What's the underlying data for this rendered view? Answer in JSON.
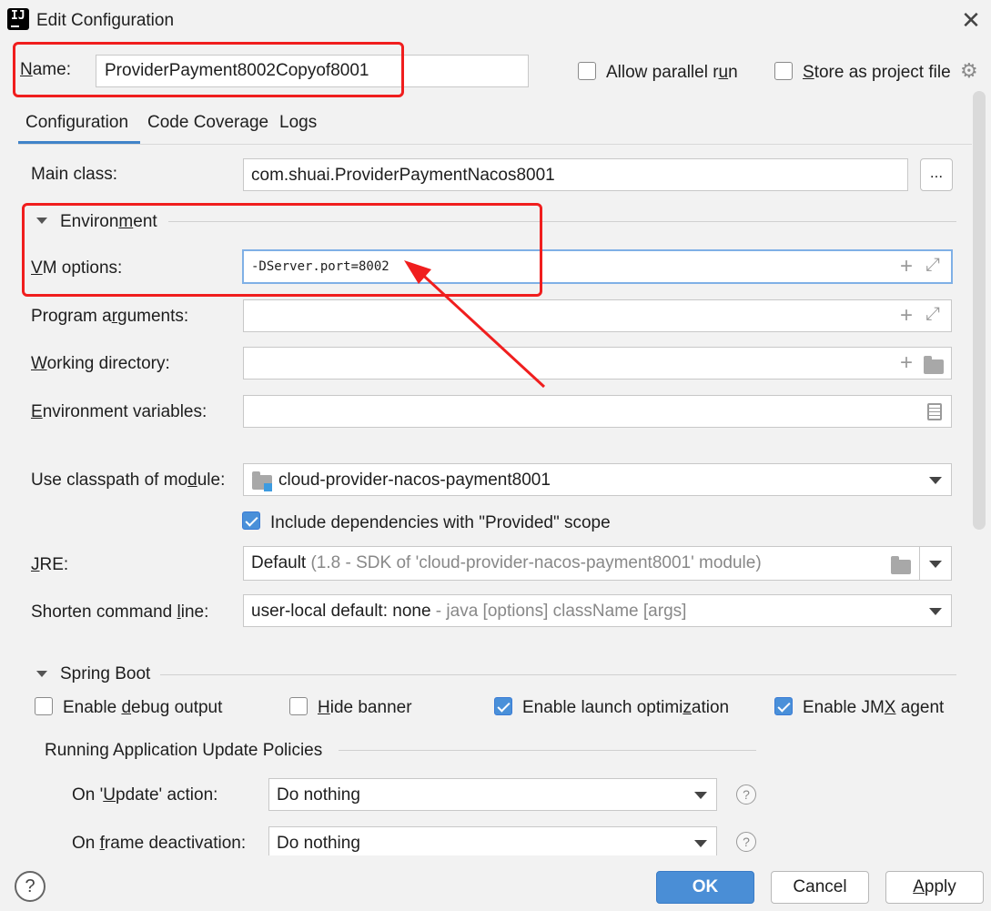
{
  "window": {
    "title": "Edit Configuration",
    "close_label": "✕"
  },
  "top": {
    "name_label": "Name:",
    "name_value": "ProviderPayment8002Copyof8001",
    "allow_parallel_label": "Allow parallel run",
    "allow_parallel_checked": false,
    "store_project_label": "Store as project file",
    "store_project_checked": false
  },
  "tabs": [
    {
      "label": "Configuration",
      "active": true
    },
    {
      "label": "Code Coverage",
      "active": false
    },
    {
      "label": "Logs",
      "active": false
    }
  ],
  "config": {
    "main_class_label": "Main class:",
    "main_class_value": "com.shuai.ProviderPaymentNacos8001",
    "browse_label": "...",
    "environment_section": "Environment",
    "vm_options_label": "VM options:",
    "vm_options_value": "-DServer.port=8002",
    "program_args_label": "Program arguments:",
    "program_args_value": "",
    "working_dir_label": "Working directory:",
    "working_dir_value": "",
    "env_vars_label": "Environment variables:",
    "env_vars_value": "",
    "classpath_label": "Use classpath of module:",
    "classpath_value": "cloud-provider-nacos-payment8001",
    "include_deps_label": "Include dependencies with \"Provided\" scope",
    "include_deps_checked": true,
    "jre_label": "JRE:",
    "jre_value": "Default",
    "jre_detail": "(1.8 - SDK of 'cloud-provider-nacos-payment8001' module)",
    "shorten_label": "Shorten command line:",
    "shorten_value": "user-local default: none",
    "shorten_detail": "- java [options] className [args]"
  },
  "spring_boot": {
    "section": "Spring Boot",
    "debug_output_label": "Enable debug output",
    "debug_output_checked": false,
    "hide_banner_label": "Hide banner",
    "hide_banner_checked": false,
    "launch_opt_label": "Enable launch optimization",
    "launch_opt_checked": true,
    "jmx_label": "Enable JMX agent",
    "jmx_checked": true,
    "policies_section": "Running Application Update Policies",
    "on_update_label": "On 'Update' action:",
    "on_update_value": "Do nothing",
    "on_frame_label": "On frame deactivation:",
    "on_frame_value": "Do nothing"
  },
  "buttons": {
    "help": "?",
    "ok": "OK",
    "cancel": "Cancel",
    "apply": "Apply"
  },
  "colors": {
    "accent": "#4a8ed6",
    "annotation": "#f01e1e",
    "tab_underline": "#4083c9"
  }
}
